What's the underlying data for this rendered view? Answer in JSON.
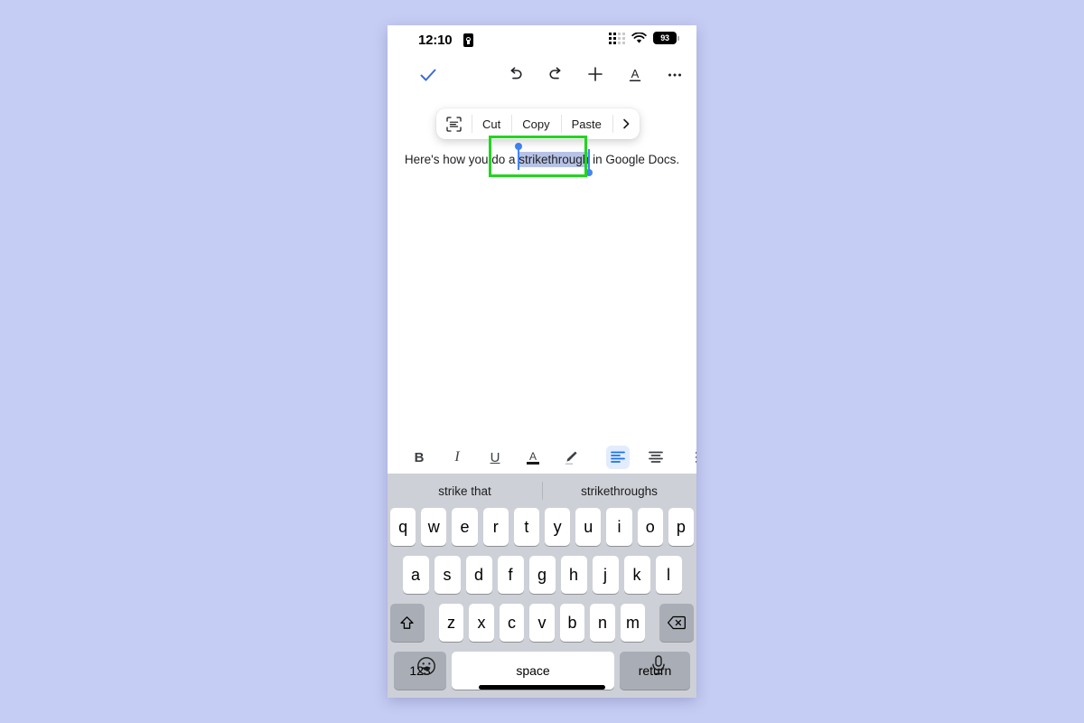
{
  "statusbar": {
    "time": "12:10",
    "lock_icon": "lock-portrait-icon",
    "signal_icon": "cellular-signal-icon",
    "wifi_icon": "wifi-icon",
    "battery_level": "93"
  },
  "app_toolbar": {
    "done_icon": "checkmark-icon",
    "undo_icon": "undo-icon",
    "redo_icon": "redo-icon",
    "add_icon": "plus-icon",
    "format_icon": "text-format-a-icon",
    "more_icon": "more-options-icon",
    "accent_color": "#3b6bd6"
  },
  "context_menu": {
    "scan_icon": "scan-text-icon",
    "items": [
      {
        "label": "Cut"
      },
      {
        "label": "Copy"
      },
      {
        "label": "Paste"
      }
    ],
    "more_icon": "chevron-right-icon"
  },
  "document": {
    "text_before": "Here's how you do a ",
    "selected_text": "strikethrough",
    "text_after": " in Google Docs.",
    "selection_color": "#b7c3e6",
    "handle_color": "#4285f4"
  },
  "annotation": {
    "color": "#22d520"
  },
  "format_toolbar": {
    "bold_label": "B",
    "italic_label": "I",
    "underline_label": "U",
    "text_color_label": "A",
    "highlight_icon": "highlighter-pen-icon",
    "align_left_icon": "align-left-icon",
    "align_center_icon": "align-center-icon",
    "list_icon": "bulleted-list-icon",
    "active_tool": "align-left",
    "active_color": "#1a73e8"
  },
  "keyboard": {
    "suggestions": [
      "strike that",
      "strikethroughs"
    ],
    "row1": [
      "q",
      "w",
      "e",
      "r",
      "t",
      "y",
      "u",
      "i",
      "o",
      "p"
    ],
    "row2": [
      "a",
      "s",
      "d",
      "f",
      "g",
      "h",
      "j",
      "k",
      "l"
    ],
    "row3": [
      "z",
      "x",
      "c",
      "v",
      "b",
      "n",
      "m"
    ],
    "shift_icon": "shift-arrow-icon",
    "backspace_icon": "backspace-delete-icon",
    "numbers_label": "123",
    "space_label": "space",
    "return_label": "return",
    "emoji_icon": "emoji-smiley-icon",
    "mic_icon": "microphone-icon"
  }
}
